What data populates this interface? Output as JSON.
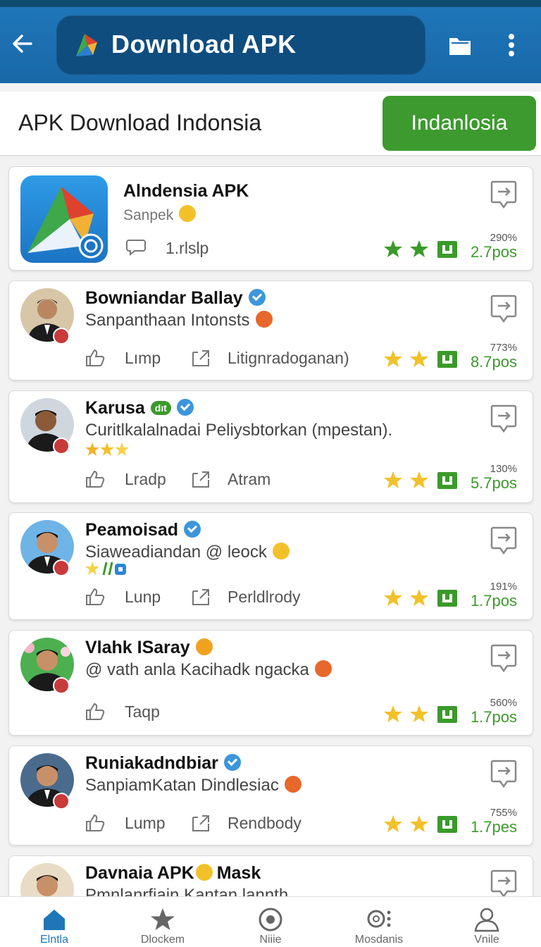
{
  "appbar": {
    "title": "Download APK",
    "icons": [
      "back-arrow-icon",
      "app-logo-icon",
      "folder-icon",
      "more-vertical-icon"
    ]
  },
  "region": {
    "title": "APK Download Indonsia",
    "button": "Indanlosia",
    "button_color": "#3c9a2e"
  },
  "colors": {
    "primary": "#1e76b8",
    "accent_green": "#3c9a2e",
    "star": "#f2c12a"
  },
  "items": [
    {
      "name": "Alndensia APK",
      "sub": "Sanpek",
      "stat": "1.rlslp",
      "pct": "290%",
      "pos": "2.7pos"
    },
    {
      "name": "Bowniandar Ballay",
      "sub": "Sanpanthaan Intonsts",
      "like": "Lımp",
      "share": "Litignradoganan)",
      "pct": "773%",
      "pos": "8.7pos"
    },
    {
      "name": "Karusa",
      "tag": "dıt",
      "sub": "Curitlkalalnadai Peliysbtorkan (mpestan).",
      "like": "Lradp",
      "share": "Atram",
      "pct": "130%",
      "pos": "5.7pos"
    },
    {
      "name": "Peamoisad",
      "sub": "Siaweadiandan @ leock",
      "like": "Lunp",
      "share": "Perldlrody",
      "pct": "191%",
      "pos": "1.7pos"
    },
    {
      "name": "Vlahk ISaray",
      "sub": "@ vath anla Kacihadk ngacka",
      "like": "Taqp",
      "pct": "560%",
      "pos": "1.7pos"
    },
    {
      "name": "Runiakadndbiar",
      "sub": "SanpiamKatan Dindlesiac",
      "like": "Lump",
      "share": "Rendbody",
      "pct": "755%",
      "pos": "1.7pes"
    },
    {
      "name": "Davnaia APK",
      "name2": "Mask",
      "sub": "Pmnlanrfiain Kantan lannth"
    }
  ],
  "bottom_nav": [
    {
      "label": "Elntla",
      "icon": "home-icon",
      "active": true
    },
    {
      "label": "Dlockem",
      "icon": "star-icon",
      "active": false
    },
    {
      "label": "Niiie",
      "icon": "radio-icon",
      "active": false
    },
    {
      "label": "Mosdanis",
      "icon": "search-settings-icon",
      "active": false
    },
    {
      "label": "Vnile",
      "icon": "user-icon",
      "active": false
    }
  ]
}
